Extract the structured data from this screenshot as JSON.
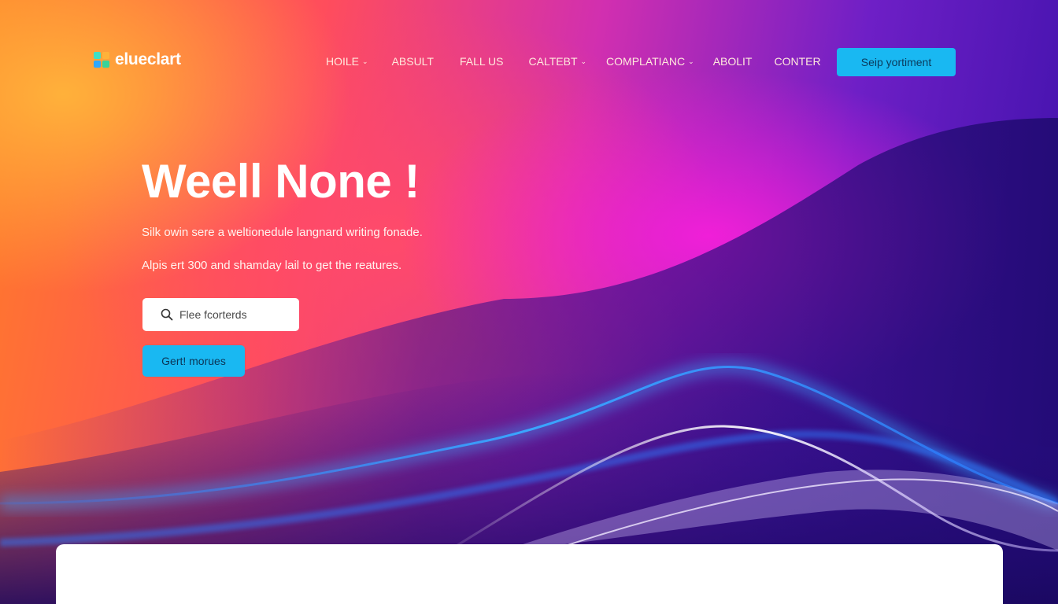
{
  "brand": {
    "name": "elueclart",
    "logo_icon": "blocks-logo-icon"
  },
  "nav": {
    "items": [
      {
        "label": "HOILE",
        "has_dropdown": true
      },
      {
        "label": "ABSULT",
        "has_dropdown": false
      },
      {
        "label": "FALL US",
        "has_dropdown": false
      },
      {
        "label": "CALTEBT",
        "has_dropdown": true
      },
      {
        "label": "COMPLATIANC",
        "has_dropdown": true
      },
      {
        "label": "ABOLIT",
        "has_dropdown": false
      },
      {
        "label": "CONTER",
        "has_dropdown": false
      }
    ],
    "cta_label": "Seip yortiment"
  },
  "hero": {
    "title": "Weell None !",
    "subtitle_1": "Silk owin sere a weltionedule langnard writing fonade.",
    "subtitle_2": "Alpis ert 300 and shamday lail to get the reatures.",
    "search_placeholder": "Flee fcorterds",
    "button_label": "Gert! morues"
  },
  "colors": {
    "accent": "#19b8f2",
    "background_start": "#ff7a2a",
    "background_mid": "#f01fd8",
    "background_end": "#3a10a8",
    "panel": "#ffffff"
  }
}
